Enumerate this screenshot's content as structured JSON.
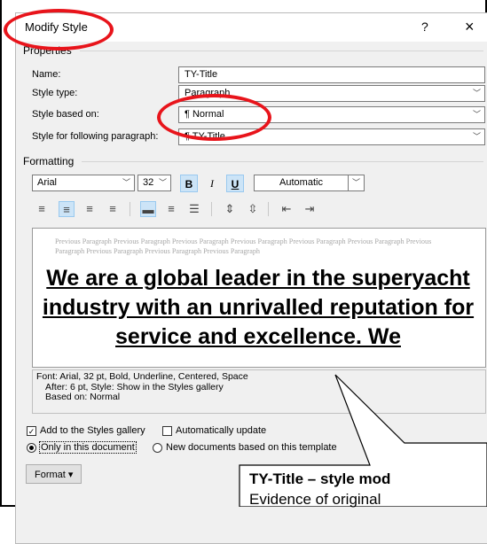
{
  "dialog": {
    "title": "Modify Style",
    "help": "?",
    "close": "×"
  },
  "properties": {
    "heading": "Properties",
    "name_label": "Name:",
    "name_value": "TY-Title",
    "type_label": "Style type:",
    "type_value": "Paragraph",
    "based_label": "Style based on:",
    "based_value": "¶  Normal",
    "following_label": "Style for following paragraph:",
    "following_value": "¶  TY-Title"
  },
  "formatting": {
    "heading": "Formatting",
    "font": "Arial",
    "size": "32",
    "bold": "B",
    "italic": "I",
    "underline": "U",
    "color": "Automatic"
  },
  "preview": {
    "previous": "Previous Paragraph Previous Paragraph Previous Paragraph Previous Paragraph Previous Paragraph Previous Paragraph Previous Paragraph Previous Paragraph Previous Paragraph Previous Paragraph",
    "sample": "We are a global leader in the superyacht industry with an unrivalled reputation for service and excellence. We"
  },
  "description": {
    "line1": "Font: Arial, 32 pt, Bold, Underline, Centered, Space",
    "line2": "After:  6 pt, Style: Show in the Styles gallery",
    "line3": "Based on: Normal"
  },
  "options": {
    "add_gallery": "Add to the Styles gallery",
    "auto_update": "Automatically update",
    "only_doc": "Only in this document",
    "new_docs": "New documents based on this template"
  },
  "buttons": {
    "format": "Format ▾"
  },
  "callout": {
    "title": "TY-Title – style mod",
    "subtitle": "Evidence of original"
  },
  "colors": {
    "highlight_ring": "#e8141b",
    "selected_button": "#cce4f7"
  }
}
